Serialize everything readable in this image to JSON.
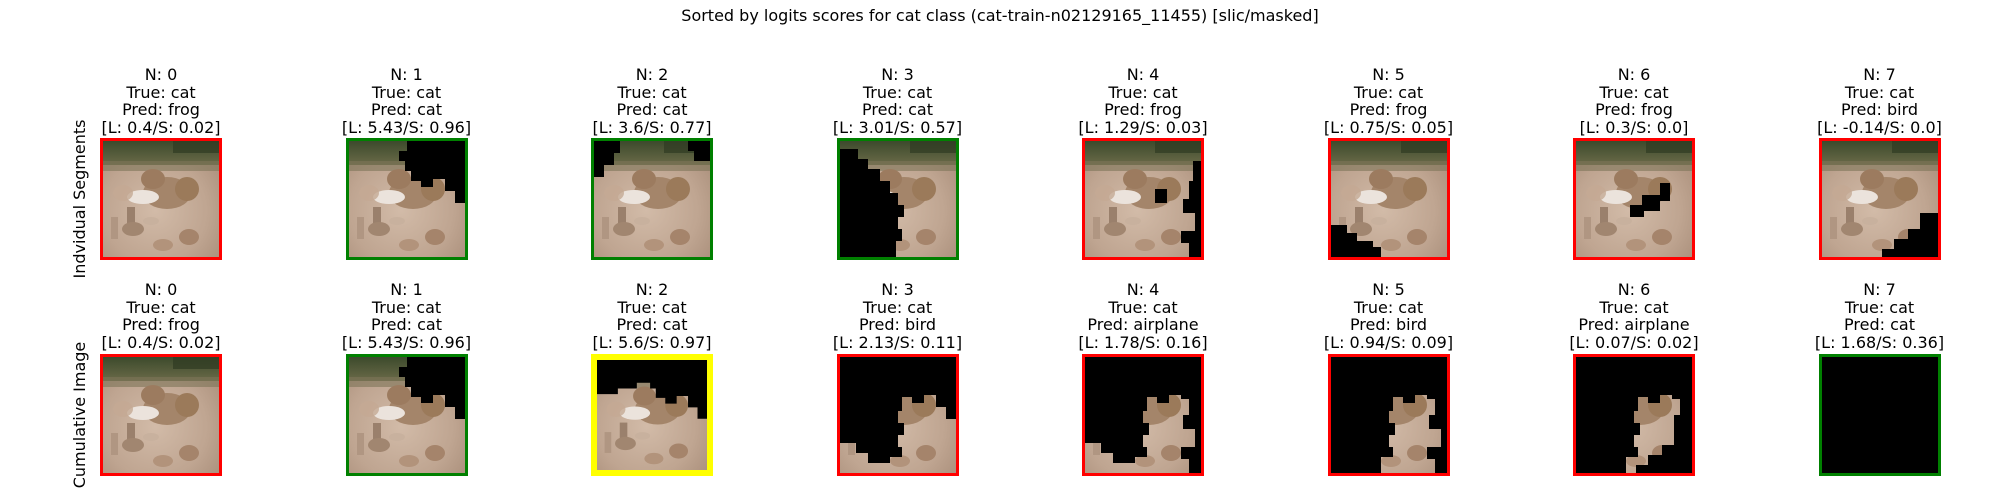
{
  "chart_data": {
    "type": "image-grid",
    "title": "Sorted by logits scores for cat class (cat-train-n02129165_11455) [slic/masked]",
    "colors": {
      "correct": "#008000",
      "wrong": "#ff0000",
      "best": "#ffff00"
    },
    "rows": [
      {
        "label": "Indvidual Segments",
        "panels": [
          {
            "n": "N: 0",
            "true": "True: cat",
            "pred": "Pred: frog",
            "score": "[L: 0.4/S: 0.02]",
            "border": "wrong",
            "mask": "none"
          },
          {
            "n": "N: 1",
            "true": "True: cat",
            "pred": "Pred: cat",
            "score": "[L: 5.43/S: 0.96]",
            "border": "correct",
            "mask": "ind-1"
          },
          {
            "n": "N: 2",
            "true": "True: cat",
            "pred": "Pred: cat",
            "score": "[L: 3.6/S: 0.77]",
            "border": "correct",
            "mask": "ind-2"
          },
          {
            "n": "N: 3",
            "true": "True: cat",
            "pred": "Pred: cat",
            "score": "[L: 3.01/S: 0.57]",
            "border": "correct",
            "mask": "ind-3"
          },
          {
            "n": "N: 4",
            "true": "True: cat",
            "pred": "Pred: frog",
            "score": "[L: 1.29/S: 0.03]",
            "border": "wrong",
            "mask": "ind-4"
          },
          {
            "n": "N: 5",
            "true": "True: cat",
            "pred": "Pred: frog",
            "score": "[L: 0.75/S: 0.05]",
            "border": "wrong",
            "mask": "ind-5"
          },
          {
            "n": "N: 6",
            "true": "True: cat",
            "pred": "Pred: frog",
            "score": "[L: 0.3/S: 0.0]",
            "border": "wrong",
            "mask": "ind-6"
          },
          {
            "n": "N: 7",
            "true": "True: cat",
            "pred": "Pred: bird",
            "score": "[L: -0.14/S: 0.0]",
            "border": "wrong",
            "mask": "ind-7"
          }
        ]
      },
      {
        "label": "Cumulative Image",
        "panels": [
          {
            "n": "N: 0",
            "true": "True: cat",
            "pred": "Pred: frog",
            "score": "[L: 0.4/S: 0.02]",
            "border": "wrong",
            "mask": "none"
          },
          {
            "n": "N: 1",
            "true": "True: cat",
            "pred": "Pred: cat",
            "score": "[L: 5.43/S: 0.96]",
            "border": "correct",
            "mask": "cum-1"
          },
          {
            "n": "N: 2",
            "true": "True: cat",
            "pred": "Pred: cat",
            "score": "[L: 5.6/S: 0.97]",
            "border": "best",
            "mask": "cum-2"
          },
          {
            "n": "N: 3",
            "true": "True: cat",
            "pred": "Pred: bird",
            "score": "[L: 2.13/S: 0.11]",
            "border": "wrong",
            "mask": "cum-3"
          },
          {
            "n": "N: 4",
            "true": "True: cat",
            "pred": "Pred: airplane",
            "score": "[L: 1.78/S: 0.16]",
            "border": "wrong",
            "mask": "cum-4"
          },
          {
            "n": "N: 5",
            "true": "True: cat",
            "pred": "Pred: bird",
            "score": "[L: 0.94/S: 0.09]",
            "border": "wrong",
            "mask": "cum-5"
          },
          {
            "n": "N: 6",
            "true": "True: cat",
            "pred": "Pred: airplane",
            "score": "[L: 0.07/S: 0.02]",
            "border": "wrong",
            "mask": "cum-6"
          },
          {
            "n": "N: 7",
            "true": "True: cat",
            "pred": "Pred: cat",
            "score": "[L: 1.68/S: 0.36]",
            "border": "correct",
            "mask": "cum-7"
          }
        ]
      }
    ]
  }
}
